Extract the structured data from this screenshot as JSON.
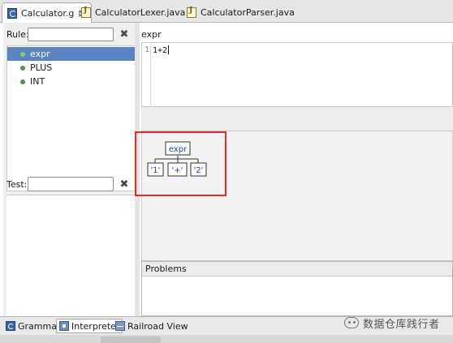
{
  "editor_tabs": [
    {
      "label": "Calculator.g",
      "icon": "antlr-grammar-file-icon",
      "active": true,
      "close": "⊠"
    },
    {
      "label": "CalculatorLexer.java",
      "icon": "java-file-icon",
      "active": false
    },
    {
      "label": "CalculatorParser.java",
      "icon": "java-file-icon",
      "active": false
    }
  ],
  "rule_panel": {
    "label": "Rule:",
    "filter_value": "",
    "clear_symbol": "✖",
    "items": [
      {
        "label": "expr",
        "selected": true
      },
      {
        "label": "PLUS",
        "selected": false
      },
      {
        "label": "INT",
        "selected": false
      }
    ]
  },
  "test_panel": {
    "label": "Test:",
    "value": "",
    "clear_symbol": "✖"
  },
  "editor": {
    "rule_name": "expr",
    "line_number": "1",
    "code": "1+2"
  },
  "parse_tree": {
    "root": "expr",
    "children": [
      "'1'",
      "'+'",
      "'2'"
    ]
  },
  "problems_panel": {
    "title": "Problems"
  },
  "bottom_tabs": [
    {
      "label": "Grammar",
      "icon": "grammar-icon",
      "active": false
    },
    {
      "label": "Interpreter",
      "icon": "interpreter-icon",
      "active": true
    },
    {
      "label": "Railroad View",
      "icon": "railroad-icon",
      "active": false
    }
  ],
  "watermark": {
    "text": "数据仓库践行者"
  },
  "colors": {
    "selection": "#5c83c4",
    "rule_dot": "#4c9a3e",
    "highlight_box": "#e02a2a",
    "tree_text": "#1f3f97"
  }
}
